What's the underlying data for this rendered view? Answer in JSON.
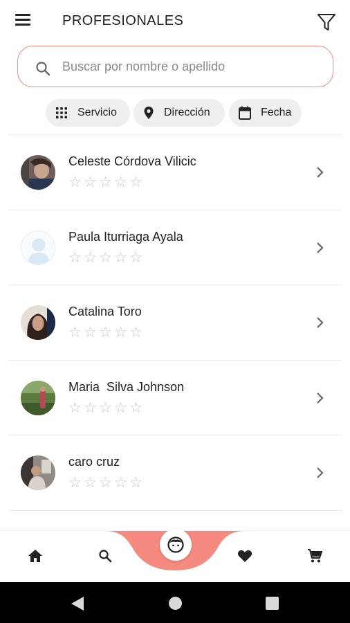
{
  "header": {
    "title": "PROFESIONALES",
    "menu_icon": "hamburger-menu-icon",
    "filter_icon": "filter-funnel-icon"
  },
  "search": {
    "placeholder": "Buscar por nombre o apellido",
    "value": ""
  },
  "chips": [
    {
      "label": "Servicio",
      "icon": "grid-icon"
    },
    {
      "label": "Dirección",
      "icon": "location-pin-icon"
    },
    {
      "label": "Fecha",
      "icon": "calendar-icon"
    }
  ],
  "professionals": [
    {
      "name": "Celeste Córdova Vilicic",
      "rating": 0,
      "max_rating": 5
    },
    {
      "name": "Paula Iturriaga Ayala",
      "rating": 0,
      "max_rating": 5
    },
    {
      "name": "Catalina Toro",
      "rating": 0,
      "max_rating": 5
    },
    {
      "name": "Maria  Silva Johnson",
      "rating": 0,
      "max_rating": 5
    },
    {
      "name": "caro cruz",
      "rating": 0,
      "max_rating": 5
    }
  ],
  "bottom_nav": [
    {
      "icon": "home-icon"
    },
    {
      "icon": "search-icon"
    },
    {
      "icon": "face-icon",
      "active": true
    },
    {
      "icon": "heart-icon"
    },
    {
      "icon": "cart-icon"
    }
  ],
  "colors": {
    "accent": "#f58a7e",
    "chip_bg": "#efefef",
    "star": "#c6c6c6"
  }
}
